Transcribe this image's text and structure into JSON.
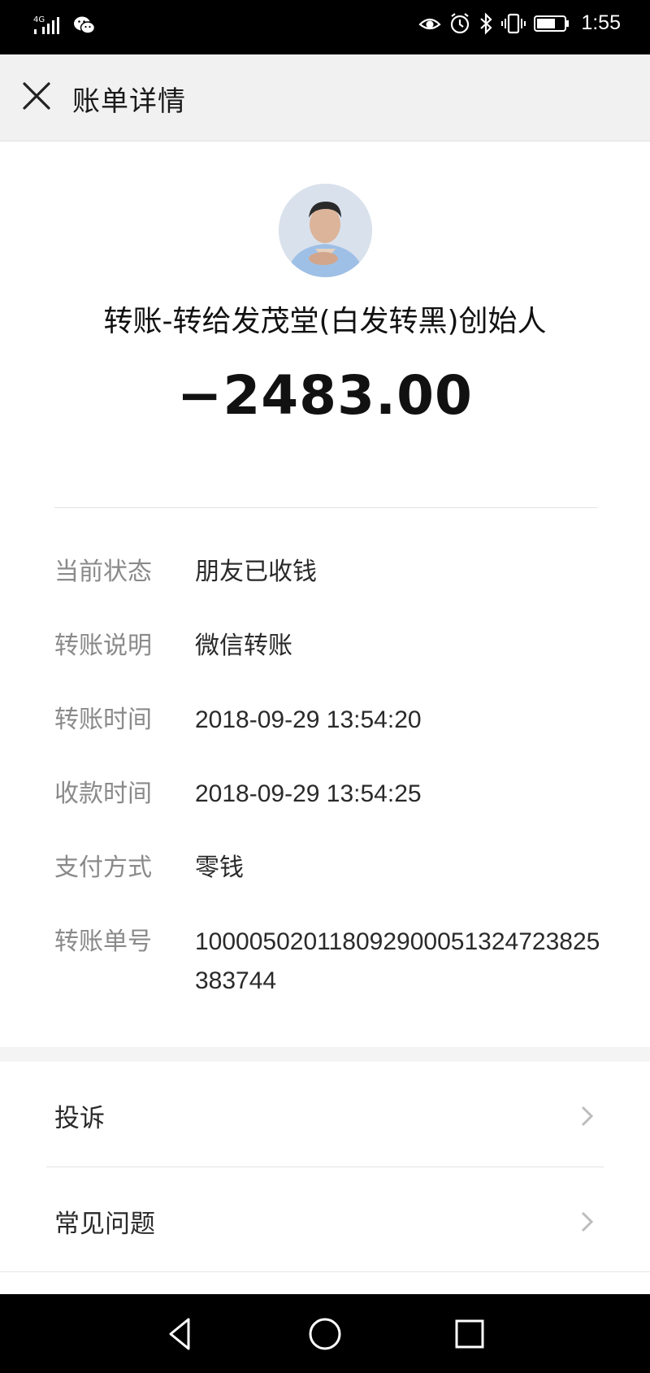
{
  "status_bar": {
    "network": "4G",
    "time": "1:55",
    "icons": [
      "signal-icon",
      "wechat-icon",
      "eye-icon",
      "alarm-icon",
      "bluetooth-icon",
      "vibrate-icon",
      "battery-icon"
    ]
  },
  "header": {
    "title": "账单详情",
    "close_icon": "close-icon"
  },
  "summary": {
    "title": "转账-转给发茂堂(白发转黑)创始人",
    "amount": "−2483.00"
  },
  "details": [
    {
      "label": "当前状态",
      "value": "朋友已收钱"
    },
    {
      "label": "转账说明",
      "value": "微信转账"
    },
    {
      "label": "转账时间",
      "value": "2018-09-29 13:54:20"
    },
    {
      "label": "收款时间",
      "value": "2018-09-29 13:54:25"
    },
    {
      "label": "支付方式",
      "value": "零钱"
    },
    {
      "label": "转账单号",
      "value": "100005020118092900051324723825383744"
    }
  ],
  "links": [
    {
      "label": "投诉"
    },
    {
      "label": "常见问题"
    }
  ],
  "nav_bar": [
    "back-icon",
    "home-icon",
    "recents-icon"
  ],
  "colors": {
    "status_bar_bg": "#000000",
    "header_bg": "#f1f1f1",
    "label_gray": "#8a8a8a",
    "text_dark": "#2a2a2a"
  }
}
